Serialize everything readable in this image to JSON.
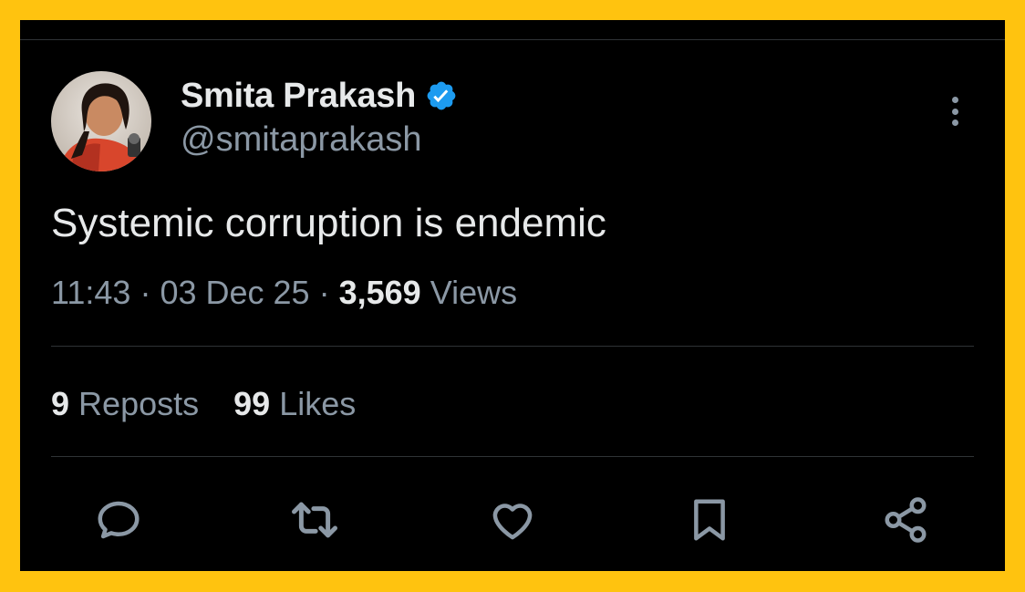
{
  "tweet": {
    "author_name": "Smita Prakash",
    "author_handle": "@smitaprakash",
    "text": "Systemic corruption is endemic",
    "time": "11:43",
    "date": "03 Dec 25",
    "separator": "·",
    "views_count": "3,569",
    "views_label": "Views",
    "reposts_count": "9",
    "reposts_label": "Reposts",
    "likes_count": "99",
    "likes_label": "Likes"
  },
  "icons": {
    "verified": "verified-badge-icon",
    "more": "more-vertical-icon",
    "reply": "reply-icon",
    "repost": "repost-icon",
    "like": "like-icon",
    "bookmark": "bookmark-icon",
    "share": "share-icon"
  },
  "colors": {
    "border_frame": "#FFC30F",
    "background": "#000000",
    "primary_text": "#E7E9EA",
    "secondary_text": "#8B98A5",
    "verified_blue": "#1D9BF0",
    "divider": "#2F3336"
  }
}
